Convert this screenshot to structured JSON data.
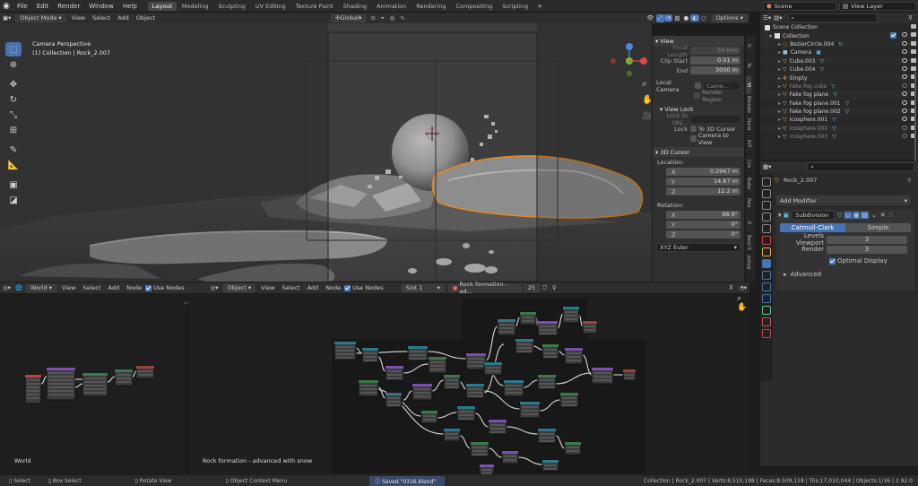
{
  "menu": {
    "items": [
      "File",
      "Edit",
      "Render",
      "Window",
      "Help"
    ],
    "workspaces": [
      "Layout",
      "Modeling",
      "Sculpting",
      "UV Editing",
      "Texture Paint",
      "Shading",
      "Animation",
      "Rendering",
      "Compositing",
      "Scripting"
    ],
    "active_workspace": "Layout",
    "scene": "Scene",
    "view_layer": "View Layer"
  },
  "viewport_header": {
    "mode": "Object Mode",
    "menus": [
      "View",
      "Select",
      "Add",
      "Object"
    ],
    "transform": "Global",
    "options": "Options"
  },
  "viewport": {
    "title": "Camera Perspective",
    "subtitle": "(1) Collection | Rock_2.007"
  },
  "npanel": {
    "view_header": "View",
    "focal_length_label": "Focal Length",
    "focal_length": "50 mm",
    "clip_start_label": "Clip Start",
    "clip_start": "0.01 m",
    "end_label": "End",
    "end": "3000 m",
    "local_camera_label": "Local Camera",
    "local_camera_value": "Came...",
    "render_region": "Render Region",
    "view_lock_header": "View Lock",
    "lock_to_obj_label": "Lock to Obj...",
    "lock_label": "Lock",
    "to_3d_cursor": "To 3D Cursor",
    "camera_to_view": "Camera to View",
    "cursor_header": "3D Cursor",
    "location_label": "Location:",
    "x_label": "X",
    "y_label": "Y",
    "z_label": "Z",
    "loc_x": "0.2967 m",
    "loc_y": "14.67 m",
    "loc_z": "12.2 m",
    "rotation_label": "Rotation:",
    "rot_x": "98.9°",
    "rot_y": "0°",
    "rot_z": "0°",
    "euler": "XYZ Euler",
    "tabs": [
      "It",
      "To",
      "Vi",
      "Blende",
      "Hard",
      "KIT",
      "Cre",
      "Bake",
      "Rea",
      "E",
      "Real S",
      "polyg"
    ]
  },
  "outliner": {
    "root": "Scene Collection",
    "collection": "Collection",
    "items": [
      {
        "name": "BezierCircle.004",
        "type": "curve",
        "color": "#e6a84c",
        "dim": false
      },
      {
        "name": "Camera",
        "type": "camera",
        "color": "#9fbbd8",
        "dim": false
      },
      {
        "name": "Cube.003",
        "type": "mesh",
        "color": "#e6a84c",
        "dim": false
      },
      {
        "name": "Cube.004",
        "type": "mesh",
        "color": "#e6a84c",
        "dim": false
      },
      {
        "name": "Empty",
        "type": "empty",
        "color": "#e6a84c",
        "dim": false
      },
      {
        "name": "Fake fog cube",
        "type": "mesh",
        "color": "#e6a84c",
        "dim": true
      },
      {
        "name": "Fake fog plane",
        "type": "mesh",
        "color": "#e6a84c",
        "dim": false
      },
      {
        "name": "Fake fog plane.001",
        "type": "mesh",
        "color": "#e6a84c",
        "dim": false
      },
      {
        "name": "Fake fog plane.002",
        "type": "mesh",
        "color": "#e6a84c",
        "dim": false
      },
      {
        "name": "Icosphere.001",
        "type": "mesh",
        "color": "#e6a84c",
        "dim": false
      },
      {
        "name": "Icosphere.002",
        "type": "mesh",
        "color": "#e6a84c",
        "dim": true
      },
      {
        "name": "Icosphere.003",
        "type": "mesh",
        "color": "#e6a84c",
        "dim": true
      }
    ]
  },
  "properties": {
    "object_name": "Rock_2.007",
    "add_modifier": "Add Modifier",
    "modifier_name": "Subdivision",
    "catmull": "Catmull-Clark",
    "simple": "Simple",
    "levels_viewport_label": "Levels Viewport",
    "levels_viewport": "3",
    "render_label": "Render",
    "render": "3",
    "optimal_display": "Optimal Display",
    "advanced": "Advanced"
  },
  "world_editor": {
    "type": "World",
    "menus": [
      "View",
      "Select",
      "Add",
      "Node"
    ],
    "use_nodes": "Use Nodes",
    "label": "World"
  },
  "material_editor": {
    "type": "Object",
    "menus": [
      "View",
      "Select",
      "Add",
      "Node"
    ],
    "use_nodes": "Use Nodes",
    "slot": "Slot 1",
    "material": "Rock formation - ad...",
    "users": "25",
    "label": "Rock formation - advanced with snow"
  },
  "status": {
    "select": "Select",
    "box_select": "Box Select",
    "rotate_view": "Rotate View",
    "context_menu": "Object Context Menu",
    "saved": "Saved \"0316.blend\"",
    "stats": "Collection | Rock_2.007 | Verts:8,510,198 | Faces:8,509,118 | Tris:17,010,044 | Objects:1/36 | 2.92.0"
  },
  "colors": {
    "accent": "#4772b3",
    "selection": "#e08a1e",
    "mesh_icon": "#e6a84c",
    "modifier_icon": "#66c2e8"
  }
}
